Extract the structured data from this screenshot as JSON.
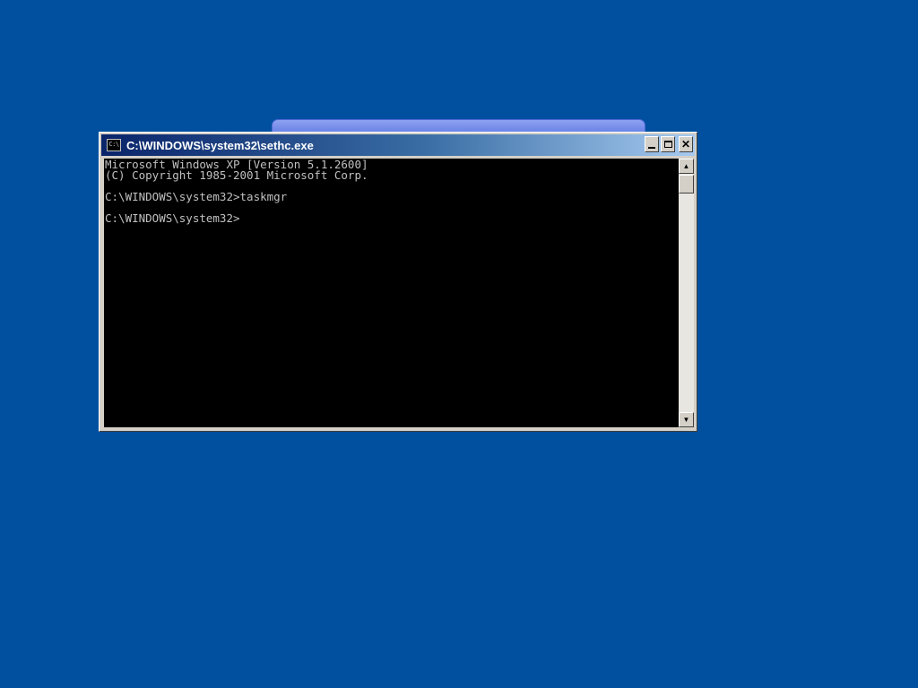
{
  "desktop": {
    "background_color": "#00509F"
  },
  "console_window": {
    "title": "C:\\WINDOWS\\system32\\sethc.exe",
    "icon": "cmd-icon",
    "icon_text": "C:\\",
    "buttons": {
      "minimize": "minimize-icon",
      "maximize": "maximize-icon",
      "close": "✕"
    },
    "lines": [
      "Microsoft Windows XP [Version 5.1.2600]",
      "(C) Copyright 1985-2001 Microsoft Corp.",
      "",
      "C:\\WINDOWS\\system32>taskmgr",
      "",
      "C:\\WINDOWS\\system32>"
    ],
    "scrollbar": {
      "up_arrow": "▲",
      "down_arrow": "▼"
    },
    "colors": {
      "screen_bg": "#000000",
      "text": "#C0C0C0"
    }
  }
}
